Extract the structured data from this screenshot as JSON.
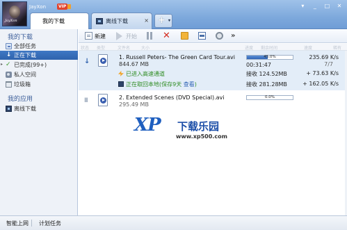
{
  "user": {
    "name": "JayXon",
    "avatar_label": "JayXon",
    "vip_badge": "VIP"
  },
  "tabs": [
    {
      "label": "我的下载",
      "active": true
    },
    {
      "label": "离线下载",
      "active": false,
      "close": "×"
    }
  ],
  "new_tab": {
    "plus": "+",
    "arrow": "▾"
  },
  "window_buttons": {
    "minimize": "_",
    "maximize": "□",
    "close": "✕",
    "menu": "▾"
  },
  "sidebar": {
    "downloads_title": "我的下载",
    "items": [
      {
        "label": "全部任务"
      },
      {
        "label": "正在下载",
        "selected": true
      },
      {
        "label": "已完成(99+)",
        "expander": "▸"
      },
      {
        "label": "私人空间"
      },
      {
        "label": "垃圾箱"
      }
    ],
    "apps_title": "我的应用",
    "apps": [
      {
        "label": "离线下载"
      }
    ]
  },
  "toolbar": {
    "new_label": "新建",
    "start_label": "开始",
    "more": "»"
  },
  "list_header": [
    "状态",
    "类型",
    "文件名",
    "大小",
    "进度",
    "剩余时间",
    "速度",
    "稀有"
  ],
  "downloads": [
    {
      "name": "1. Russell Peters- The Green Card Tour.avi",
      "size": "844.67 MB",
      "progress_text": "45.0%",
      "progress": 0.45,
      "remaining": "00:31:47",
      "speed": "235.69 K/s",
      "pieces": "7/7",
      "accel_1": "已进入高速通道",
      "recv_1": "接收 124.52MB",
      "plus_1": "+ 73.63 K/s",
      "accel_2_text": "正在取回本地(保存9天 ",
      "accel_2_link": "查看",
      "accel_2_end": ")",
      "recv_2": "接收 281.28MB",
      "plus_2": "+ 162.05 K/s"
    },
    {
      "name": "2. Extended Scenes (DVD Special).avi",
      "size": "295.49 MB",
      "progress_text": "0.0%",
      "progress": 0.0
    }
  ],
  "watermark": {
    "xp": "XP",
    "title": "下载乐园",
    "url": "www.xp500.com"
  },
  "statusbar": {
    "item1": "智能上网",
    "item2": "计划任务"
  },
  "colors": {
    "accent": "#2f63ad",
    "titlebar": "#7ea9dc",
    "progress": "#2f64b5",
    "delete": "#d42a1e",
    "green": "#2f8c23"
  }
}
